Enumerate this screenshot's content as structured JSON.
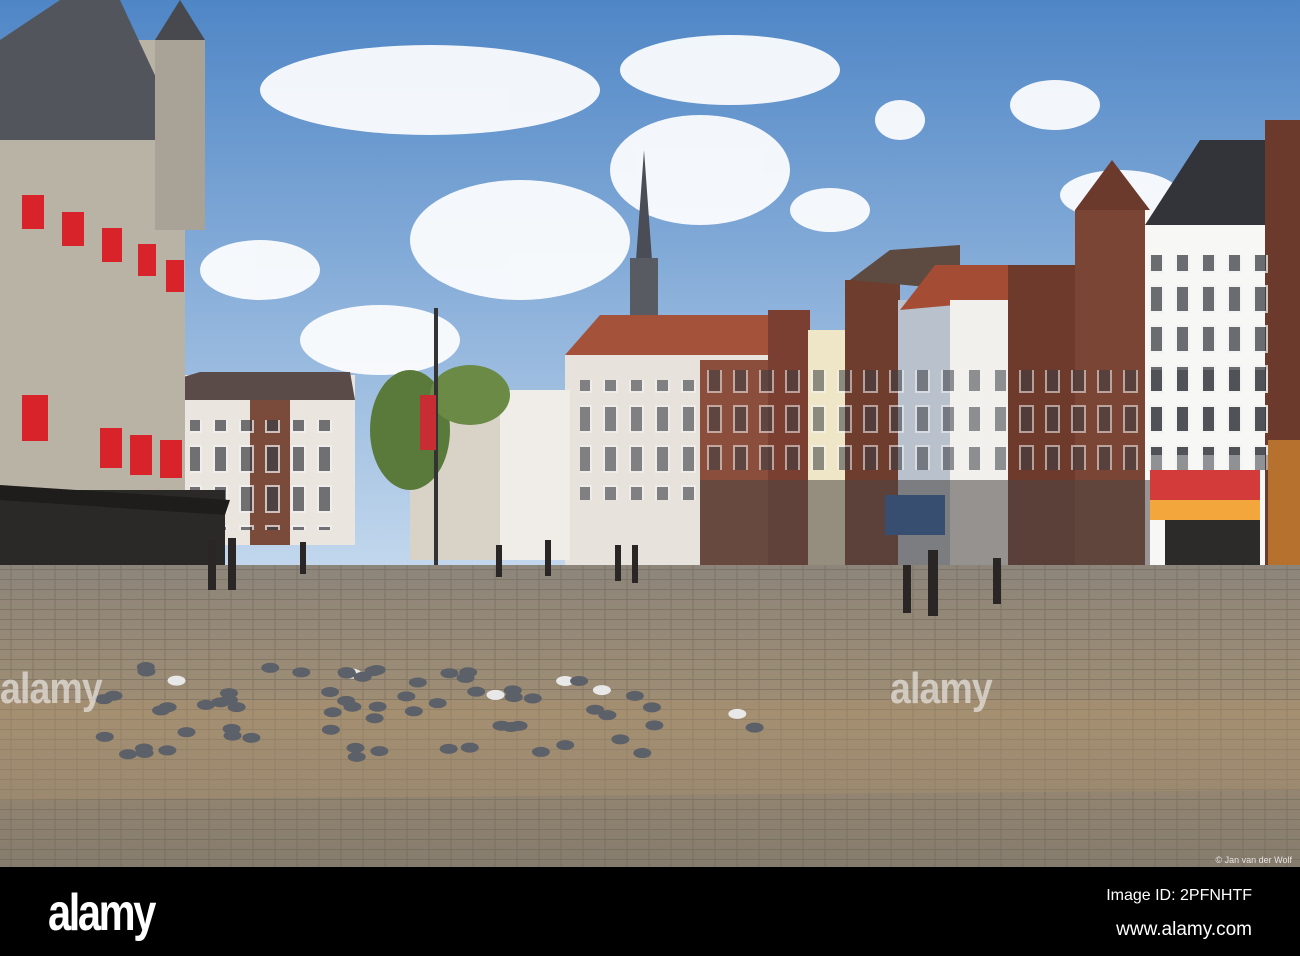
{
  "photo": {
    "credit": "© Jan van der Wolf",
    "watermark": "alamy"
  },
  "footer": {
    "logo": "alamy",
    "image_id": "Image ID: 2PFNHTF",
    "website": "www.alamy.com"
  },
  "colors": {
    "sky_top": "#4f86c6",
    "sky_bottom": "#c9dcef",
    "cobble": "#8a8172",
    "shutter_red": "#d8232a"
  }
}
